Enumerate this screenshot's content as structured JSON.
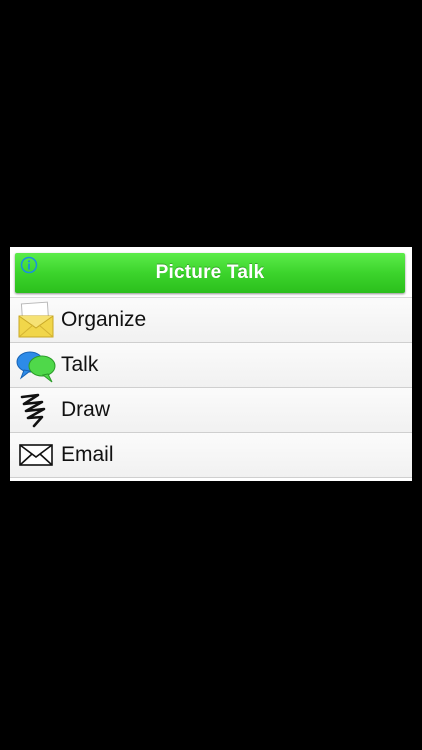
{
  "header": {
    "title": "Picture Talk",
    "color": "#3cd42c",
    "info_icon": "info-icon"
  },
  "menu": {
    "items": [
      {
        "label": "Organize",
        "icon": "envelope-open-icon"
      },
      {
        "label": "Talk",
        "icon": "speech-bubbles-icon"
      },
      {
        "label": "Draw",
        "icon": "scribble-icon"
      },
      {
        "label": "Email",
        "icon": "mail-icon"
      }
    ]
  }
}
